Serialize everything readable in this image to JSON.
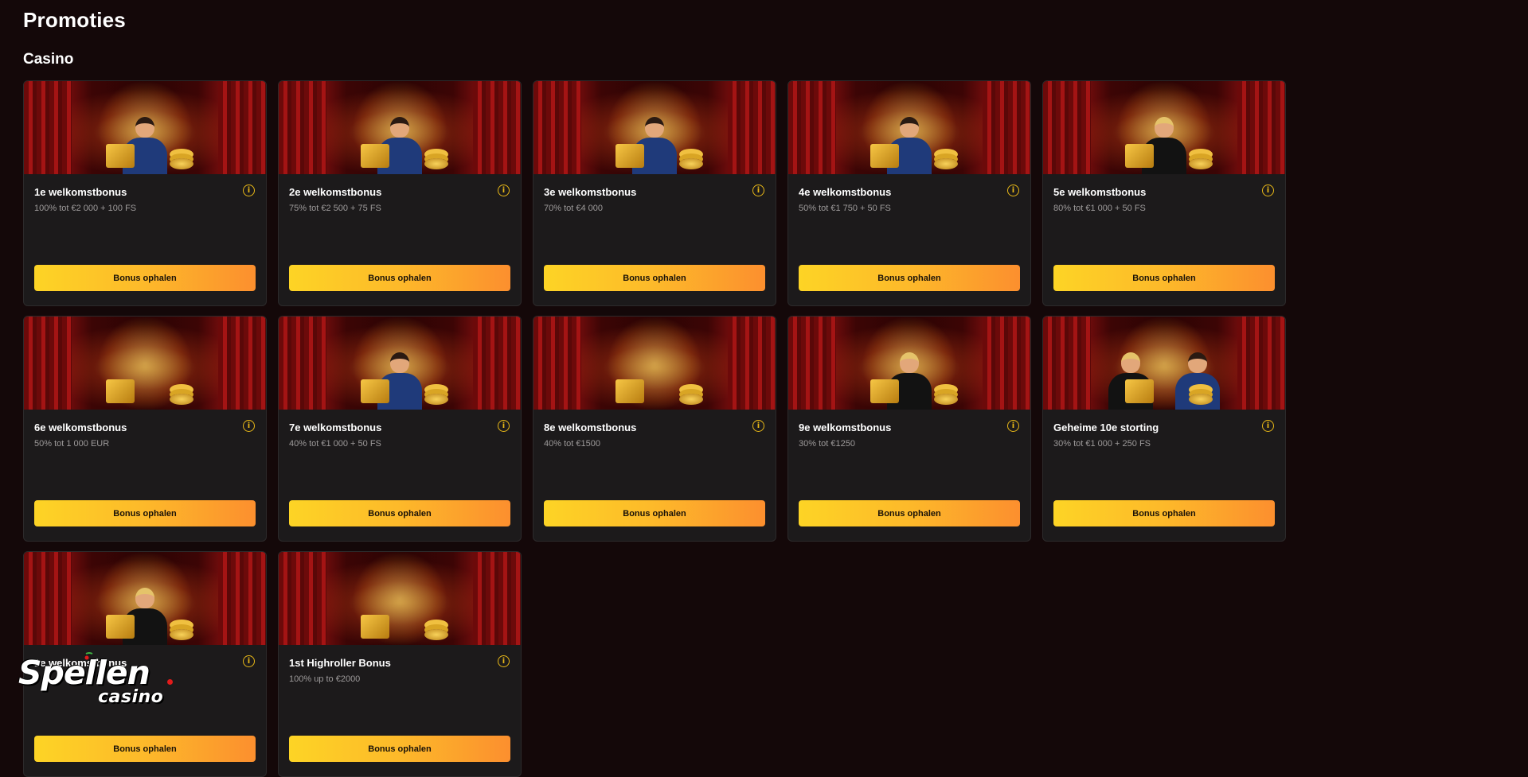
{
  "page": {
    "title": "Promoties"
  },
  "section": {
    "title": "Casino"
  },
  "cards": [
    {
      "title": "1e welkomstbonus",
      "desc": "100% tot €2 000 + 100 FS",
      "button": "Bonus ophalen",
      "figure": "man",
      "prop": "gift-box"
    },
    {
      "title": "2e welkomstbonus",
      "desc": "75% tot €2 500 + 75 FS",
      "button": "Bonus ophalen",
      "figure": "man",
      "prop": "gold-safe"
    },
    {
      "title": "3e welkomstbonus",
      "desc": "70% tot €4 000",
      "button": "Bonus ophalen",
      "figure": "man",
      "prop": "treasure-case"
    },
    {
      "title": "4e welkomstbonus",
      "desc": "50% tot €1 750 + 50 FS",
      "button": "Bonus ophalen",
      "figure": "man",
      "prop": "money-bag"
    },
    {
      "title": "5e welkomstbonus",
      "desc": "80% tot €1 000 + 50 FS",
      "button": "Bonus ophalen",
      "figure": "blonde",
      "prop": "gift-box"
    },
    {
      "title": "6e welkomstbonus",
      "desc": "50% tot 1 000 EUR",
      "button": "Bonus ophalen",
      "figure": "none",
      "prop": "gift-pile"
    },
    {
      "title": "7e welkomstbonus",
      "desc": "40% tot €1 000 + 50 FS",
      "button": "Bonus ophalen",
      "figure": "man",
      "prop": "treasure-chest"
    },
    {
      "title": "8e welkomstbonus",
      "desc": "40% tot €1500",
      "button": "Bonus ophalen",
      "figure": "none",
      "prop": "chips-cocktail"
    },
    {
      "title": "9e welkomstbonus",
      "desc": "30% tot €1250",
      "button": "Bonus ophalen",
      "figure": "blonde",
      "prop": "trophy"
    },
    {
      "title": "Geheime 10e storting",
      "desc": "30% tot €1 000 + 250 FS",
      "button": "Bonus ophalen",
      "figure": "couple",
      "prop": "mystery-box"
    },
    {
      "title": "1e welkomstbonus",
      "desc": "",
      "button": "Bonus ophalen",
      "figure": "blonde",
      "prop": "roulette"
    },
    {
      "title": "1st Highroller Bonus",
      "desc": "100% up to €2000",
      "button": "Bonus ophalen",
      "figure": "none",
      "prop": "diamond-coins"
    }
  ],
  "info_icon_glyph": "i",
  "logo": {
    "word": "Spellen",
    "sub": "casino"
  },
  "colors": {
    "background": "#140809",
    "card": "#1c1a1b",
    "accent": "#e8b818",
    "button_start": "#fdd425",
    "button_end": "#fc8f2e",
    "logo_dot": "#e21b1b"
  }
}
